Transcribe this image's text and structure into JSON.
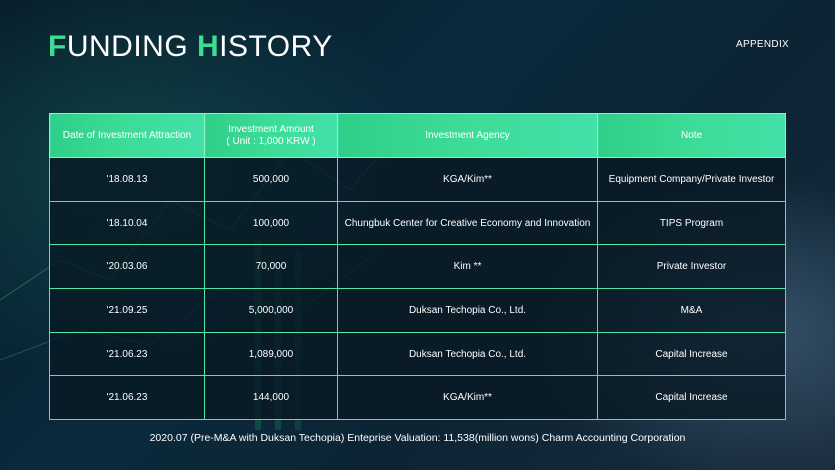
{
  "header": {
    "title_parts": [
      {
        "text": "F",
        "accent": true
      },
      {
        "text": "UNDING ",
        "accent": false
      },
      {
        "text": "H",
        "accent": true
      },
      {
        "text": "ISTORY",
        "accent": false
      }
    ],
    "appendix_label": "APPENDIX"
  },
  "table": {
    "columns": [
      {
        "label": "Date of Investment Attraction"
      },
      {
        "label": "Investment Amount",
        "sub": "( Unit : 1,000 KRW )"
      },
      {
        "label": "Investment Agency"
      },
      {
        "label": "Note"
      }
    ],
    "rows": [
      {
        "date": "'18.08.13",
        "amount": "500,000",
        "agency": "KGA/Kim**",
        "note": "Equipment Company/Private Investor"
      },
      {
        "date": "'18.10.04",
        "amount": "100,000",
        "agency": "Chungbuk Center for Creative Economy and Innovation",
        "note": "TIPS Program"
      },
      {
        "date": "'20.03.06",
        "amount": "70,000",
        "agency": "Kim **",
        "note": "Private Investor"
      },
      {
        "date": "'21.09.25",
        "amount": "5,000,000",
        "agency": "Duksan Techopia Co., Ltd.",
        "note": "M&A"
      },
      {
        "date": "'21.06.23",
        "amount": "1,089,000",
        "agency": "Duksan Techopia Co., Ltd.",
        "note": "Capital Increase"
      },
      {
        "date": "'21.06.23",
        "amount": "144,000",
        "agency": "KGA/Kim**",
        "note": "Capital Increase"
      }
    ]
  },
  "footer": {
    "text": "2020.07 (Pre-M&A with Duksan Techopia) Enteprise Valuation: 11,538(million wons) Charm Accounting Corporation"
  },
  "colors": {
    "accent": "#3ddc97",
    "header_bg": "#3ddc97",
    "cell_bg": "#081822",
    "border": "#4fe4a8"
  }
}
